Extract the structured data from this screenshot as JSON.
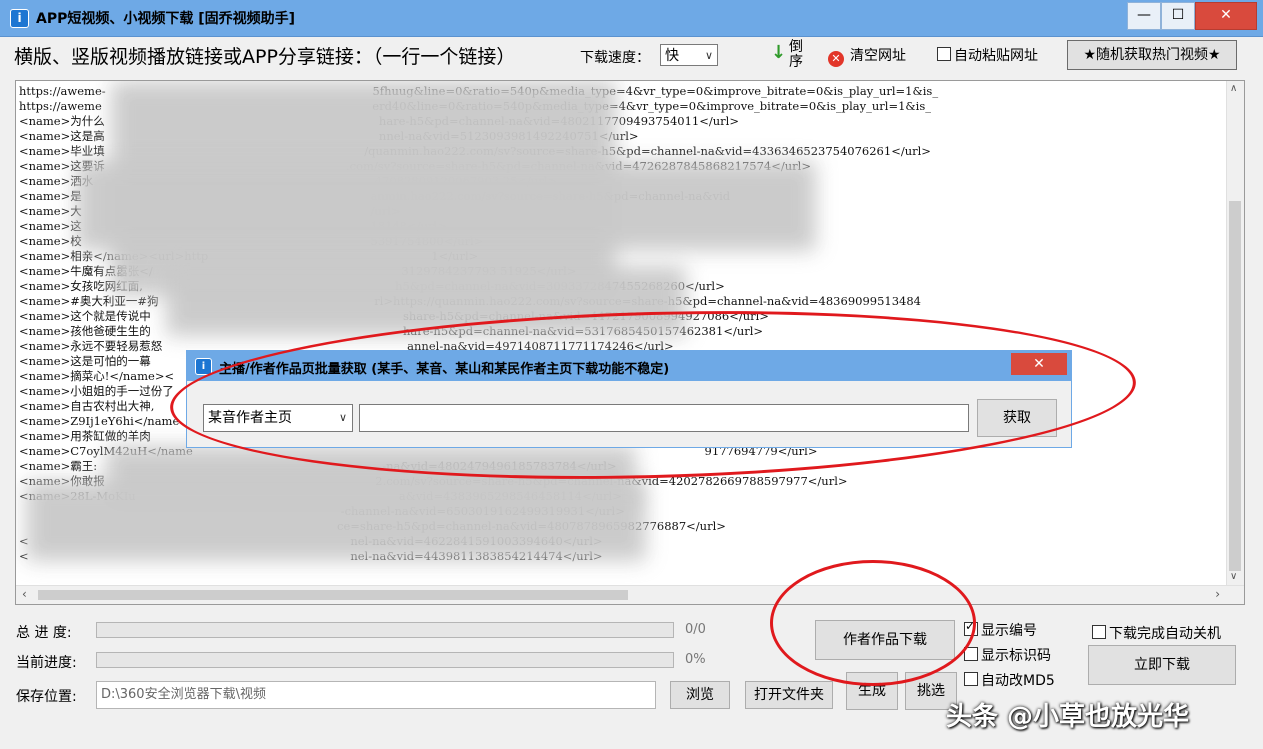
{
  "window": {
    "title": "APP短视频、小视频下载 [固乔视频助手]",
    "icon_glyph": "i",
    "minimize_glyph": "—",
    "maximize_glyph": "☐",
    "close_glyph": "✕"
  },
  "toolbar": {
    "links_label": "横版、竖版视频播放链接或APP分享链接：（一行一个链接）",
    "speed_label": "下载速度：",
    "speed_value": "快",
    "reverse_label": "倒序",
    "reverse_icon": "↓",
    "clear_label": "清空网址",
    "clear_icon": "✕",
    "autopaste_label": "自动粘贴网址",
    "autopaste_checked": false,
    "hot_video_label": "★随机获取热门视频★"
  },
  "links": [
    "https://aweme-                                                                         5fhuug&line=0&ratio=540p&media_type=4&vr_type=0&improve_bitrate=0&is_play_url=1&is_",
    "https://aweme                                                                          erd40&line=0&ratio=540p&media_type=4&vr_type=0&improve_bitrate=0&is_play_url=1&is_",
    "<name>为什么                                                                           hare-h5&pd=channel-na&vid=4802117709493754011</url>",
    "<name>这是高                                                                           nnel-na&vid=5123093981492240751</url>",
    "<name>毕业填                                                                       /quanmin.hao222.com/sv?source=share-h5&pd=channel-na&vid=4336346523754076261</url>",
    "<name>这要诉                                                                  .com/sv?source=share-h5&pd=channel-na&vid=4726287845868217574</url>",
    "<name>洒水                                                                             47082809120067903 25</url>",
    "<name>是                                                                               anmin.hao222.com/sv?source=share-h5&pd=channel-na&vid",
    "<name>大                                                                               /url>",
    "<name>这                                                                               18148</url>",
    "<name>校                                                                               5391754800</url>",
    "<name>相亲</name><url>http                                                             1</url>",
    "<name>牛魔有点嚣张</                                                                    3129784237793 51925</url>",
    "<name>女孩吃网红面,                                                                     h5&pd=channel-na&vid=3093372847455268260</url>",
    "<name>#奥大利亚一#狗                                                           rl>https://quanmin.hao222.com/sv?source=share-h5&pd=channel-na&vid=48369099513484",
    "<name>这个就是传说中                                                                     share-h5&pd=channel-na&vid=4472179008994927086</url>",
    "<name>孩他爸硬生生的                                                                     hare-h5&pd=channel-na&vid=5317685450157462381</url>",
    "<name>永远不要轻易惹怒                                                                   annel-na&vid=4971408711771174246</url>",
    "<name>这是可怕的一幕",
    "<name>摘菜心!</name><",
    "<name>小姐姐的手一过份了",
    "<name>自古农村出大神,                                                                                                                                            6996171386138876</ur",
    "<name>Z9Ij1eY6hi</name",
    "<name>用茶缸做的羊肉",
    "<name>C7oylM42uH</name                                                                                                                                            9177694779</url>",
    "<name>霸王:                                                                              -na&vid=4802479496185783784</url>",
    "<name>你敢报                                                                          2.com/sv?source=share-h5&pd=channel-na&vid=4202782669788597977</url>",
    "<name>28L-MoKIu                                                                        a&vid=4383965298546458114</url>",
    "                                                                                        -channel-na&vid=6503019162499319931</url>",
    "                                                                                       ce=share-h5&pd=channel-na&vid=4807878965982776887</url>",
    "<                                                                                        nel-na&vid=4622841591003394640</url>",
    "<                                                                                        nel-na&vid=4439811383854214474</url>"
  ],
  "progress": {
    "total_label": "总 进 度:",
    "total_value": "0/0",
    "total_fraction": 0,
    "current_label": "当前进度:",
    "current_value": "0%",
    "current_fraction": 0,
    "save_label": "保存位置:",
    "save_path": "D:\\360安全浏览器下载\\视频"
  },
  "buttons": {
    "browse": "浏览",
    "open_folder": "打开文件夹",
    "generate": "生成",
    "pick": "挑选",
    "author_download": "作者作品下载",
    "download_now": "立即下载"
  },
  "options": {
    "show_number_label": "显示编号",
    "show_number_checked": true,
    "show_id_label": "显示标识码",
    "show_id_checked": false,
    "auto_md5_label": "自动改MD5",
    "auto_md5_checked": false,
    "shutdown_label": "下载完成自动关机",
    "shutdown_checked": false
  },
  "dialog": {
    "title": "主播/作者作品页批量获取 (某手、某音、某山和某民作者主页下载功能不稳定)",
    "close_glyph": "✕",
    "platform_value": "某音作者主页",
    "url_value": "",
    "fetch_label": "获取"
  },
  "watermark": "头条 @小草也放光华",
  "colors": {
    "titlebar": "#6ea9e6",
    "annotation_red": "#e0191d",
    "close_red": "#d94a3d"
  }
}
